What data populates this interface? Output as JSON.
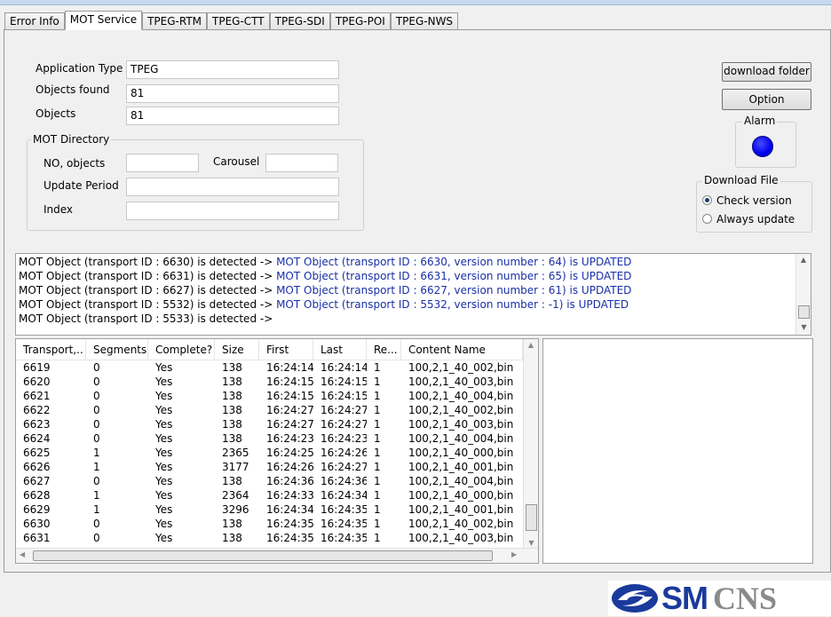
{
  "tabs": [
    "Error Info",
    "MOT Service",
    "TPEG-RTM",
    "TPEG-CTT",
    "TPEG-SDI",
    "TPEG-POI",
    "TPEG-NWS"
  ],
  "fields": {
    "application_type_label": "Application Type",
    "application_type_value": "TPEG",
    "objects_found_label": "Objects found",
    "objects_found_value": "81",
    "objects_label": "Objects",
    "objects_value": "81"
  },
  "mot_directory": {
    "title": "MOT Directory",
    "no_objects_label": "NO, objects",
    "no_objects_value": "",
    "carousel_label": "Carousel",
    "carousel_value": "",
    "update_period_label": "Update Period",
    "update_period_value": "",
    "index_label": "Index",
    "index_value": ""
  },
  "buttons": {
    "download_folder": "download folder",
    "option": "Option"
  },
  "alarm": {
    "title": "Alarm",
    "color": "#0000ee"
  },
  "download_file": {
    "title": "Download File",
    "options": [
      "Check version",
      "Always update"
    ],
    "selected": "Check version"
  },
  "log": [
    {
      "a": "MOT Object (transport ID : 6630) is detected -> ",
      "b": "MOT Object (transport ID : 6630, version number : 64) is UPDATED"
    },
    {
      "a": "MOT Object (transport ID : 6631) is detected -> ",
      "b": "MOT Object (transport ID : 6631, version number : 65) is UPDATED"
    },
    {
      "a": "MOT Object (transport ID : 6627) is detected -> ",
      "b": "MOT Object (transport ID : 6627, version number : 61) is UPDATED"
    },
    {
      "a": "MOT Object (transport ID : 5532) is detected -> ",
      "b": "MOT Object (transport ID : 5532, version number : -1) is UPDATED"
    },
    {
      "a": "MOT Object (transport ID : 5533) is detected -> ",
      "b": ""
    }
  ],
  "table": {
    "columns": [
      "Transport,..",
      "Segments",
      "Complete?",
      "Size",
      "First",
      "Last",
      "Re...",
      "Content Name"
    ],
    "rows": [
      [
        "6619",
        "0",
        "Yes",
        "138",
        "16:24:14",
        "16:24:14",
        "1",
        "100,2,1_40_002,bin"
      ],
      [
        "6620",
        "0",
        "Yes",
        "138",
        "16:24:15",
        "16:24:15",
        "1",
        "100,2,1_40_003,bin"
      ],
      [
        "6621",
        "0",
        "Yes",
        "138",
        "16:24:15",
        "16:24:15",
        "1",
        "100,2,1_40_004,bin"
      ],
      [
        "6622",
        "0",
        "Yes",
        "138",
        "16:24:27",
        "16:24:27",
        "1",
        "100,2,1_40_002,bin"
      ],
      [
        "6623",
        "0",
        "Yes",
        "138",
        "16:24:27",
        "16:24:27",
        "1",
        "100,2,1_40_003,bin"
      ],
      [
        "6624",
        "0",
        "Yes",
        "138",
        "16:24:23",
        "16:24:23",
        "1",
        "100,2,1_40_004,bin"
      ],
      [
        "6625",
        "1",
        "Yes",
        "2365",
        "16:24:25",
        "16:24:26",
        "1",
        "100,2,1_40_000,bin"
      ],
      [
        "6626",
        "1",
        "Yes",
        "3177",
        "16:24:26",
        "16:24:27",
        "1",
        "100,2,1_40_001,bin"
      ],
      [
        "6627",
        "0",
        "Yes",
        "138",
        "16:24:36",
        "16:24:36",
        "1",
        "100,2,1_40_004,bin"
      ],
      [
        "6628",
        "1",
        "Yes",
        "2364",
        "16:24:33",
        "16:24:34",
        "1",
        "100,2,1_40_000,bin"
      ],
      [
        "6629",
        "1",
        "Yes",
        "3296",
        "16:24:34",
        "16:24:35",
        "1",
        "100,2,1_40_001,bin"
      ],
      [
        "6630",
        "0",
        "Yes",
        "138",
        "16:24:35",
        "16:24:35",
        "1",
        "100,2,1_40_002,bin"
      ],
      [
        "6631",
        "0",
        "Yes",
        "138",
        "16:24:35",
        "16:24:35",
        "1",
        "100,2,1_40_003,bin"
      ]
    ]
  },
  "logo": {
    "text_sm": "SM",
    "text_cns": "CNS",
    "sm_color": "#1a3a9c",
    "cns_color": "#8a8a8a"
  }
}
